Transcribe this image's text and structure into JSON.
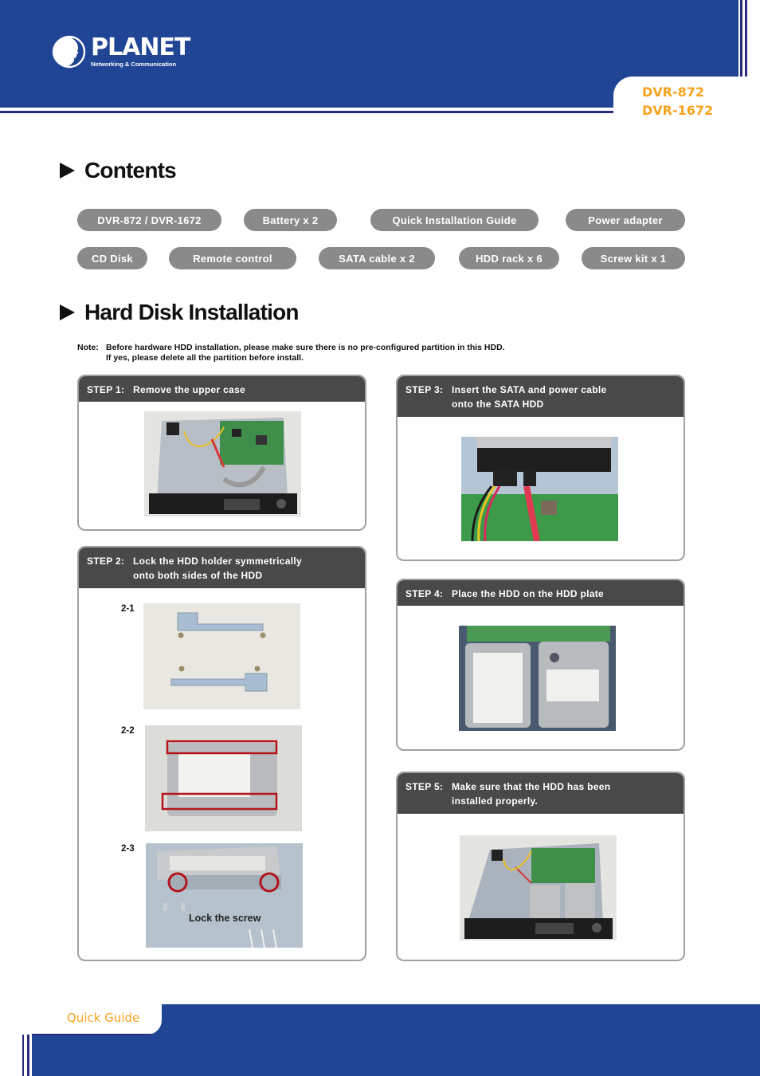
{
  "header": {
    "brand": "PLANET",
    "tagline": "Networking & Communication",
    "models": [
      "DVR-872",
      "DVR-1672"
    ]
  },
  "contents": {
    "title": "Contents",
    "items": [
      "DVR-872 / DVR-1672",
      "Battery x 2",
      "Quick Installation Guide",
      "Power adapter",
      "CD Disk",
      "Remote control",
      "SATA cable x 2",
      "HDD rack x 6",
      "Screw kit x 1"
    ]
  },
  "installation": {
    "title": "Hard Disk Installation",
    "note_label": "Note:",
    "note_lines": [
      "Before hardware HDD installation, please make sure there is no pre-configured partition in this HDD.",
      "If yes, please delete all the partition before install."
    ],
    "steps": [
      {
        "num": "STEP 1:",
        "lines": [
          "Remove the upper case"
        ]
      },
      {
        "num": "STEP 2:",
        "lines": [
          "Lock the HDD holder symmetrically",
          "onto both sides of the HDD"
        ],
        "substeps": [
          "2-1",
          "2-2",
          "2-3"
        ],
        "callout": "Lock the screw"
      },
      {
        "num": "STEP 3:",
        "lines": [
          "Insert the SATA and power cable",
          "onto the SATA HDD"
        ]
      },
      {
        "num": "STEP 4:",
        "lines": [
          "Place the HDD on the HDD plate"
        ]
      },
      {
        "num": "STEP 5:",
        "lines": [
          "Make sure that the HDD has been",
          "installed properly."
        ]
      }
    ]
  },
  "footer": {
    "label": "Quick Guide"
  },
  "colors": {
    "brand_blue": "#214595",
    "accent_orange": "#f7a21b",
    "pill_gray": "#8b8a8b",
    "step_header": "#4a4949"
  }
}
